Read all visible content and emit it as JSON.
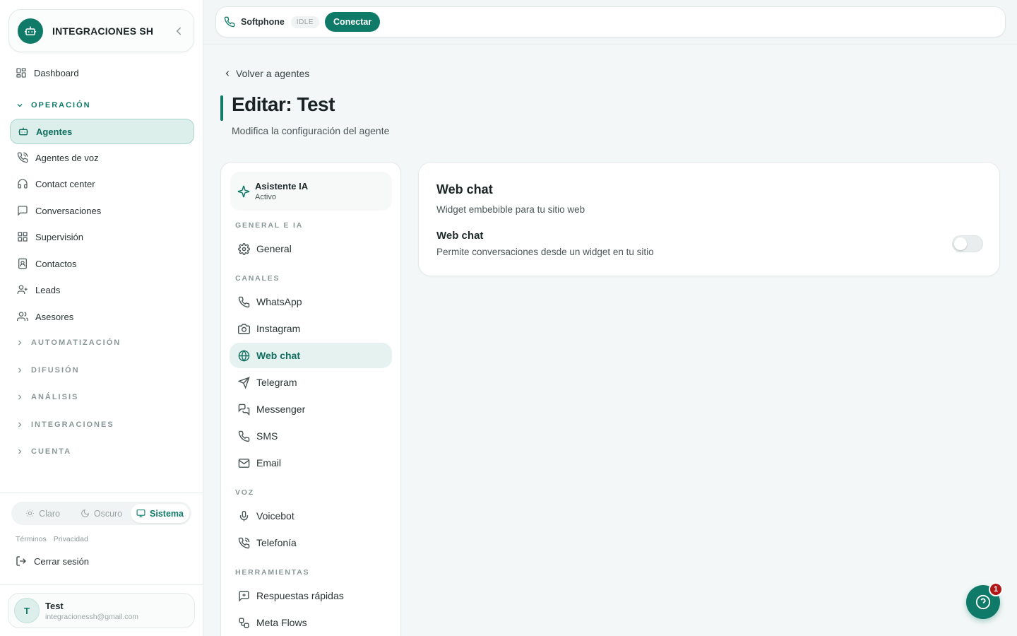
{
  "brand": {
    "name": "INTEGRACIONES SH"
  },
  "sidebar": {
    "dashboard": "Dashboard",
    "sections": {
      "operacion": "OPERACIÓN",
      "automatizacion": "AUTOMATIZACIÓN",
      "difusion": "DIFUSIÓN",
      "analisis": "ANÁLISIS",
      "integraciones": "INTEGRACIONES",
      "cuenta": "CUENTA"
    },
    "items": [
      {
        "label": "Agentes",
        "icon": "bot-icon",
        "active": true
      },
      {
        "label": "Agentes de voz",
        "icon": "phone-call-icon"
      },
      {
        "label": "Contact center",
        "icon": "headphones-icon"
      },
      {
        "label": "Conversaciones",
        "icon": "message-square-icon"
      },
      {
        "label": "Supervisión",
        "icon": "grid-icon"
      },
      {
        "label": "Contactos",
        "icon": "contact-book-icon"
      },
      {
        "label": "Leads",
        "icon": "user-plus-icon"
      },
      {
        "label": "Asesores",
        "icon": "users-icon"
      }
    ],
    "theme": {
      "light": "Claro",
      "dark": "Oscuro",
      "system": "Sistema",
      "selected": "Sistema"
    },
    "legal": {
      "terms": "Términos",
      "privacy": "Privacidad"
    },
    "logout": "Cerrar sesión",
    "user": {
      "initial": "T",
      "name": "Test",
      "email": "integracionessh@gmail.com"
    }
  },
  "topbar": {
    "softphone": "Softphone",
    "status": "IDLE",
    "connect": "Conectar"
  },
  "page": {
    "back": "Volver a agentes",
    "title": "Editar: Test",
    "subtitle": "Modifica la configuración del agente"
  },
  "settings_nav": {
    "agent": {
      "name": "Asistente IA",
      "status": "Activo"
    },
    "sections": {
      "general": "GENERAL E IA",
      "canales": "CANALES",
      "voz": "VOZ",
      "herramientas": "HERRAMIENTAS"
    },
    "items": {
      "general": "General",
      "whatsapp": "WhatsApp",
      "instagram": "Instagram",
      "webchat": "Web chat",
      "telegram": "Telegram",
      "messenger": "Messenger",
      "sms": "SMS",
      "email": "Email",
      "voicebot": "Voicebot",
      "telefonia": "Telefonía",
      "respuestas": "Respuestas rápidas",
      "metaflows": "Meta Flows"
    },
    "selected": "Web chat"
  },
  "panel": {
    "title": "Web chat",
    "subtitle": "Widget embebible para tu sitio web",
    "option_title": "Web chat",
    "option_desc": "Permite conversaciones desde un widget en tu sitio",
    "enabled": false
  },
  "help": {
    "badge": "1"
  },
  "colors": {
    "accent": "#0f7a68",
    "active_bg": "#dcefeb",
    "badge": "#b01818"
  }
}
